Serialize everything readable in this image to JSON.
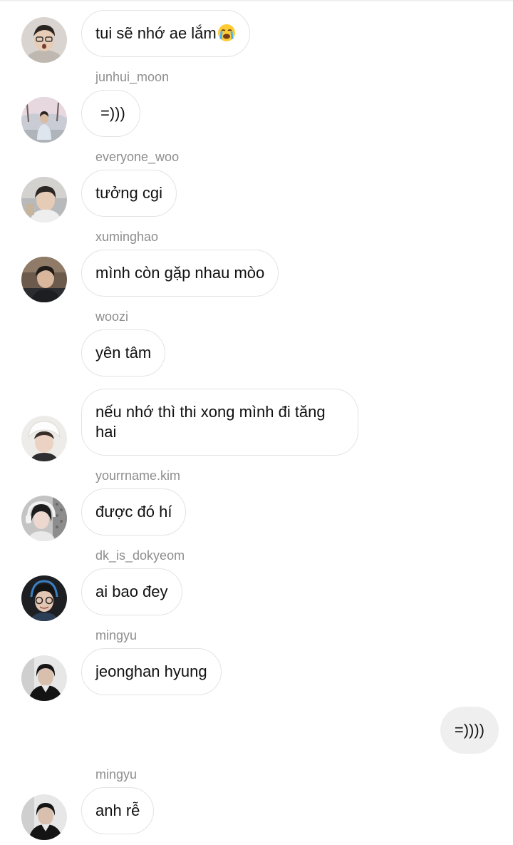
{
  "messages": [
    {
      "sender": "",
      "text": "tui sẽ nhớ ae lắm",
      "emoji": "loudly-crying-face-emoji"
    },
    {
      "sender": "junhui_moon",
      "text": "=)))"
    },
    {
      "sender": "everyone_woo",
      "text": "tưởng cgi"
    },
    {
      "sender": "xuminghao",
      "text": "mình còn gặp nhau mòo"
    },
    {
      "sender": "woozi",
      "text": "yên tâm"
    },
    {
      "sender": "",
      "text": "nếu nhớ thì thi xong mình đi tăng hai"
    },
    {
      "sender": "yourrname.kim",
      "text": "được đó hí"
    },
    {
      "sender": "dk_is_dokyeom",
      "text": "ai bao đey"
    },
    {
      "sender": "mingyu",
      "text": "jeonghan hyung"
    },
    {
      "sender": "",
      "text": "=))))",
      "outgoing": true
    },
    {
      "sender": "mingyu",
      "text": "anh rễ"
    }
  ],
  "colors": {
    "incoming_bubble_border": "#e3e3e3",
    "outgoing_bubble_bg": "#efefef",
    "username_text": "#8e8e8e",
    "message_text": "#111111"
  }
}
